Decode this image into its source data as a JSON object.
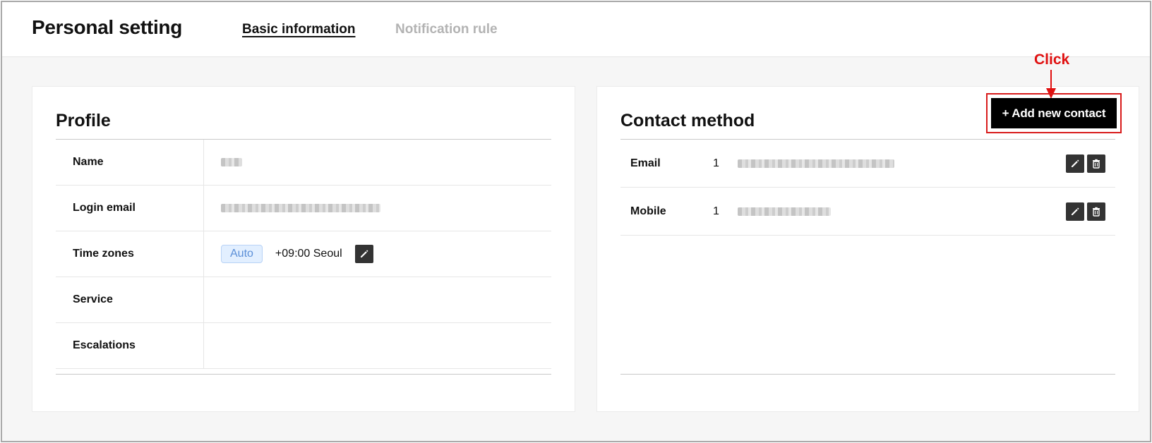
{
  "header": {
    "title": "Personal setting",
    "tabs": [
      {
        "label": "Basic information",
        "active": true
      },
      {
        "label": "Notification rule",
        "active": false
      }
    ]
  },
  "profile": {
    "title": "Profile",
    "rows": [
      {
        "label": "Name",
        "value_state": "blurred"
      },
      {
        "label": "Login email",
        "value_state": "blurred"
      },
      {
        "label": "Time zones",
        "badge": "Auto",
        "value": "+09:00 Seoul"
      },
      {
        "label": "Service",
        "value": ""
      },
      {
        "label": "Escalations",
        "value": ""
      }
    ],
    "icons": {
      "edit": "pencil-icon"
    }
  },
  "contact": {
    "title": "Contact method",
    "add_button_label": "+ Add new contact",
    "rows": [
      {
        "type": "Email",
        "priority": "1",
        "value_state": "blurred"
      },
      {
        "type": "Mobile",
        "priority": "1",
        "value_state": "blurred"
      }
    ],
    "icons": {
      "edit": "pencil-icon",
      "delete": "trash-icon"
    }
  },
  "annotation": {
    "label": "Click",
    "color": "#e01010"
  },
  "colors": {
    "accent_badge_bg": "#e2efff",
    "accent_badge_text": "#5b8fd8",
    "button_bg": "#000000",
    "icon_button_bg": "#333333"
  }
}
